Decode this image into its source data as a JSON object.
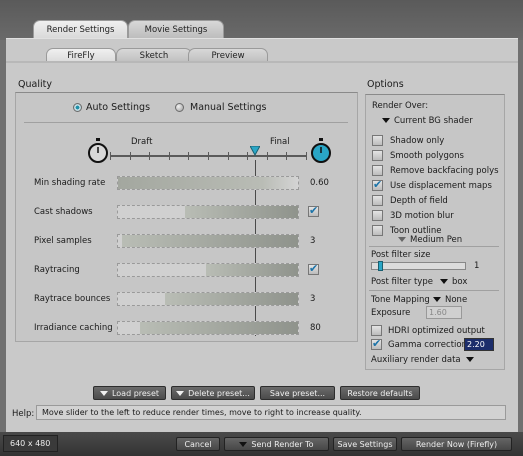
{
  "tabs_top": [
    {
      "label": "Render Settings",
      "active": true
    },
    {
      "label": "Movie Settings",
      "active": false
    }
  ],
  "tabs_sub": [
    {
      "label": "FireFly",
      "active": true
    },
    {
      "label": "Sketch",
      "active": false
    },
    {
      "label": "Preview",
      "active": false
    }
  ],
  "quality": {
    "title": "Quality",
    "auto_label": "Auto Settings",
    "manual_label": "Manual Settings",
    "mode": "auto",
    "draft_label": "Draft",
    "final_label": "Final",
    "slider_position": 0.74,
    "rows": [
      {
        "label": "Min shading rate",
        "fill": 0.0,
        "value": "0.60",
        "checkbox": null
      },
      {
        "label": "Cast shadows",
        "fill": 0.63,
        "value": "",
        "checkbox": true
      },
      {
        "label": "Pixel samples",
        "fill": 0.98,
        "value": "3",
        "checkbox": null
      },
      {
        "label": "Raytracing",
        "fill": 0.51,
        "value": "",
        "checkbox": true
      },
      {
        "label": "Raytrace bounces",
        "fill": 0.74,
        "value": "3",
        "checkbox": null
      },
      {
        "label": "Irradiance caching",
        "fill": 0.88,
        "value": "80",
        "checkbox": null
      }
    ]
  },
  "options": {
    "title": "Options",
    "render_over_label": "Render Over:",
    "render_over_value": "Current BG shader",
    "checks": [
      {
        "label": "Shadow only",
        "checked": false
      },
      {
        "label": "Smooth polygons",
        "checked": false
      },
      {
        "label": "Remove backfacing polys",
        "checked": false
      },
      {
        "label": "Use displacement maps",
        "checked": true
      },
      {
        "label": "Depth of field",
        "checked": false
      },
      {
        "label": "3D motion blur",
        "checked": false
      },
      {
        "label": "Toon outline",
        "checked": false
      }
    ],
    "toon_pen": "Medium Pen",
    "post_filter_size_label": "Post filter size",
    "post_filter_size_value": "1",
    "post_filter_type_label": "Post filter type",
    "post_filter_type_value": "box",
    "tone_mapping_label": "Tone Mapping",
    "tone_mapping_value": "None",
    "exposure_label": "Exposure",
    "exposure_value": "1.60",
    "hdri_label": "HDRI optimized output",
    "hdri_checked": false,
    "gamma_label": "Gamma correction",
    "gamma_checked": true,
    "gamma_value": "2.20",
    "aux_label": "Auxiliary render data"
  },
  "preset_buttons": {
    "load": "Load preset",
    "delete": "Delete preset...",
    "save": "Save preset...",
    "restore": "Restore defaults"
  },
  "help": {
    "label": "Help:",
    "text": "Move slider to the left to reduce render times, move to right to increase quality."
  },
  "bottom": {
    "size": "640 x 480",
    "cancel": "Cancel",
    "send_render_to": "Send Render To",
    "save_settings": "Save Settings",
    "render_now": "Render Now (Firefly)"
  },
  "colors": {
    "accent": "#1f8fa8",
    "check": "#1b73a8",
    "panel": "#c9c9c9"
  }
}
